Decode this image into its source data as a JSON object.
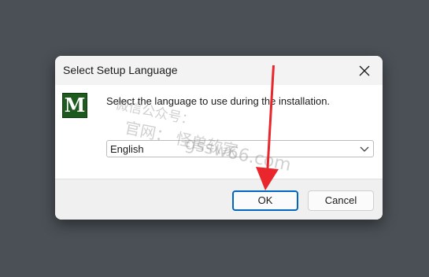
{
  "dialog": {
    "title": "Select Setup Language",
    "prompt": "Select the language to use during the installation.",
    "app_icon_letter": "M",
    "language_select": {
      "selected": "English"
    },
    "buttons": {
      "ok": "OK",
      "cancel": "Cancel"
    }
  },
  "watermark": {
    "line1": "微信公众号：",
    "line2": "官网：   怪兽软家",
    "line3": "gssw66.com"
  },
  "icons": {
    "close": "close-icon",
    "dropdown": "chevron-down-icon",
    "arrow": "red-pointer-arrow"
  },
  "colors": {
    "desktop_bg": "#4a5056",
    "dialog_bg": "#f3f3f3",
    "content_bg": "#ffffff",
    "accent": "#0067c0",
    "app_icon_bg": "#1e5a1e",
    "arrow": "#e8262b"
  }
}
